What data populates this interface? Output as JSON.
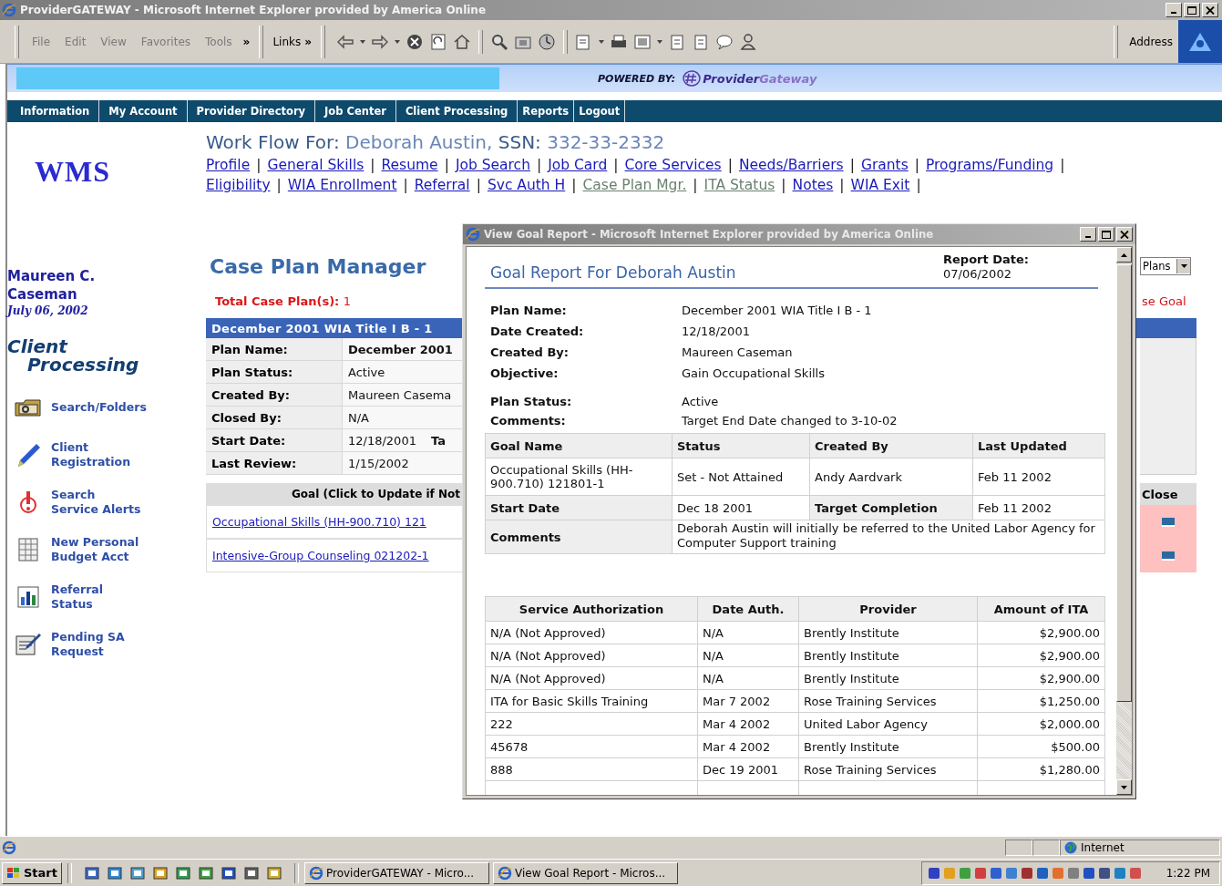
{
  "browser": {
    "title": "ProviderGATEWAY - Microsoft Internet Explorer provided by America Online",
    "menu": [
      "File",
      "Edit",
      "View",
      "Favorites",
      "Tools"
    ],
    "menu_chevron": "»",
    "links_label": "Links",
    "links_chevron": "»",
    "address_label": "Address"
  },
  "banner": {
    "powered_by": "POWERED BY:",
    "brand_first": "Provider",
    "brand_second": "Gateway"
  },
  "nav": [
    "Information",
    "My Account",
    "Provider Directory",
    "Job Center",
    "Client Processing",
    "Reports",
    "Logout"
  ],
  "sidebar": {
    "logo": "WMS",
    "user_name": "Maureen C. Caseman",
    "date": "July 06, 2002",
    "section_first": "Client",
    "section_second": "Processing",
    "items": [
      {
        "lines": [
          "Search/Folders"
        ]
      },
      {
        "lines": [
          "Client",
          "Registration"
        ]
      },
      {
        "lines": [
          "Search",
          "Service Alerts"
        ]
      },
      {
        "lines": [
          "New Personal",
          "Budget Acct"
        ]
      },
      {
        "lines": [
          "Referral",
          "Status"
        ]
      },
      {
        "lines": [
          "Pending SA",
          "Request"
        ]
      }
    ]
  },
  "workflow": {
    "label": "Work Flow For:",
    "client": "Deborah Austin,",
    "ssn_label": "SSN:",
    "ssn": "332-33-2332",
    "link_rows": [
      [
        {
          "label": "Profile",
          "visited": false,
          "separator": "|"
        },
        {
          "label": "General Skills",
          "visited": false,
          "separator": "|"
        },
        {
          "label": "Resume",
          "visited": false,
          "separator": "|"
        },
        {
          "label": "Job Search",
          "visited": false,
          "separator": "|"
        },
        {
          "label": "Job Card",
          "visited": false,
          "separator": "|"
        },
        {
          "label": "Core Services",
          "visited": false,
          "separator": "|"
        },
        {
          "label": "Needs/Barriers",
          "visited": false,
          "separator": "|"
        },
        {
          "label": "Grants",
          "visited": false,
          "separator": "|"
        },
        {
          "label": "Programs/Funding",
          "visited": false,
          "separator": "|"
        }
      ],
      [
        {
          "label": "Eligibility",
          "visited": false,
          "separator": "|"
        },
        {
          "label": "WIA Enrollment",
          "visited": false,
          "separator": "|"
        },
        {
          "label": "Referral",
          "visited": false,
          "separator": "|"
        },
        {
          "label": "Svc Auth H",
          "visited": false,
          "separator": "|"
        },
        {
          "label": "Case Plan Mgr.",
          "visited": true,
          "separator": "|"
        },
        {
          "label": "ITA Status",
          "visited": true,
          "separator": "|"
        },
        {
          "label": "Notes",
          "visited": false,
          "separator": "|"
        },
        {
          "label": "WIA Exit",
          "visited": false,
          "separator": "|"
        }
      ]
    ]
  },
  "case_plan": {
    "title": "Case Plan Manager",
    "total_label": "Total Case Plan(s):",
    "total": "1",
    "view_select": "Plans",
    "close_goal_fragment": "se Goal",
    "plan_header": "December 2001 WIA Title I B - 1",
    "fields": [
      {
        "label": "Plan Name:",
        "value": "December 2001",
        "bold": true
      },
      {
        "label": "Plan Status:",
        "value": "Active",
        "bold": false
      },
      {
        "label": "Created By:",
        "value": "Maureen Casema",
        "bold": false
      },
      {
        "label": "Closed By:",
        "value": "N/A",
        "bold": false
      },
      {
        "label": "Start Date:",
        "value": "12/18/2001",
        "bold": false,
        "trailing_label": "Ta"
      },
      {
        "label": "Last Review:",
        "value": "1/15/2002",
        "bold": false
      }
    ],
    "goal_header": "Goal (Click to Update if Not",
    "close_header": "Close",
    "goals": [
      {
        "label": "Occupational Skills (HH-900.710) 121"
      },
      {
        "label": "Intensive-Group Counseling 021202-1"
      }
    ]
  },
  "popup": {
    "title": "View Goal Report - Microsoft Internet Explorer provided by America Online",
    "report_title": "Goal Report For Deborah Austin",
    "report_date_label": "Report Date:",
    "report_date": "07/06/2002",
    "fields": [
      {
        "label": "Plan Name:",
        "value": "December 2001 WIA Title I B - 1"
      },
      {
        "label": "Date Created:",
        "value": "12/18/2001"
      },
      {
        "label": "Created By:",
        "value": "Maureen Caseman"
      },
      {
        "label": "Objective:",
        "value": "Gain Occupational Skills"
      },
      {
        "label": "Plan Status:",
        "value": "Active"
      },
      {
        "label": "Comments:",
        "value": "Target End Date changed to 3-10-02"
      }
    ],
    "goal_table": {
      "columns": [
        "Goal Name",
        "Status",
        "Created By",
        "Last Updated"
      ],
      "row": [
        "Occupational Skills (HH-900.710) 121801-1",
        "Set - Not Attained",
        "Andy Aardvark",
        "Feb 11 2002"
      ],
      "start_label": "Start Date",
      "start": "Dec 18 2001",
      "target_label": "Target Completion",
      "target": "Feb 11 2002",
      "comments_label": "Comments",
      "comments": "Deborah Austin will initially be referred to the United Labor Agency for Computer Support training"
    },
    "auth_table": {
      "columns": [
        "Service Authorization",
        "Date Auth.",
        "Provider",
        "Amount of ITA"
      ],
      "rows": [
        [
          "N/A (Not Approved)",
          "N/A",
          "Brently Institute",
          "$2,900.00"
        ],
        [
          "N/A (Not Approved)",
          "N/A",
          "Brently Institute",
          "$2,900.00"
        ],
        [
          "N/A (Not Approved)",
          "N/A",
          "Brently Institute",
          "$2,900.00"
        ],
        [
          "ITA for Basic Skills Training",
          "Mar 7 2002",
          "Rose Training Services",
          "$1,250.00"
        ],
        [
          "222",
          "Mar 4 2002",
          "United Labor Agency",
          "$2,000.00"
        ],
        [
          "45678",
          "Mar 4 2002",
          "Brently Institute",
          "$500.00"
        ],
        [
          "888",
          "Dec 19 2001",
          "Rose Training Services",
          "$1,280.00"
        ]
      ]
    }
  },
  "status_bar": {
    "zone": "Internet"
  },
  "taskbar": {
    "start": "Start",
    "tasks": [
      "ProviderGATEWAY - Micro...",
      "View Goal Report - Micros..."
    ],
    "time": "1:22 PM"
  }
}
